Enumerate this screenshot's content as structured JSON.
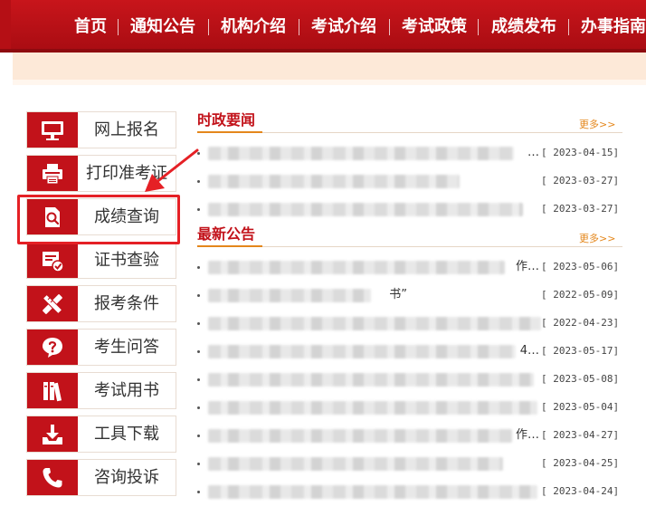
{
  "nav": {
    "items": [
      "首页",
      "通知公告",
      "机构介绍",
      "考试介绍",
      "考试政策",
      "成绩发布",
      "办事指南"
    ]
  },
  "sidebar": {
    "items": [
      {
        "label": "网上报名",
        "icon": "monitor-icon"
      },
      {
        "label": "打印准考证",
        "icon": "printer-icon"
      },
      {
        "label": "成绩查询",
        "icon": "document-search-icon"
      },
      {
        "label": "证书查验",
        "icon": "certificate-check-icon"
      },
      {
        "label": "报考条件",
        "icon": "ruler-pencil-icon"
      },
      {
        "label": "考生问答",
        "icon": "question-icon"
      },
      {
        "label": "考试用书",
        "icon": "books-icon"
      },
      {
        "label": "工具下载",
        "icon": "download-tray-icon"
      },
      {
        "label": "咨询投诉",
        "icon": "phone-icon"
      }
    ],
    "highlighted": "成绩查询"
  },
  "politics": {
    "title": "时政要闻",
    "more": "更多>>",
    "items": [
      {
        "title": "…",
        "date": "[ 2023-04-15]"
      },
      {
        "title": "",
        "date": "[ 2023-03-27]"
      },
      {
        "title": "",
        "date": "[ 2023-03-27]"
      }
    ]
  },
  "notices": {
    "title": "最新公告",
    "more": "更多>>",
    "items": [
      {
        "title": "作…",
        "date": "[ 2023-05-06]"
      },
      {
        "title": "书”",
        "date": "[ 2022-05-09]"
      },
      {
        "title": "",
        "date": "[ 2022-04-23]"
      },
      {
        "title": "4…",
        "date": "[ 2023-05-17]"
      },
      {
        "title": "",
        "date": "[ 2023-05-08]"
      },
      {
        "title": "",
        "date": "[ 2023-05-04]"
      },
      {
        "title": "作…",
        "date": "[ 2023-04-27]"
      },
      {
        "title": "",
        "date": "[ 2023-04-25]"
      },
      {
        "title": "",
        "date": "[ 2023-04-24]"
      }
    ]
  },
  "colors": {
    "brand_red": "#c2121a",
    "nav_red": "#c8151b",
    "accent_orange": "#e4871c",
    "band_peach": "#fde9d8",
    "highlight_red": "#e52025"
  }
}
